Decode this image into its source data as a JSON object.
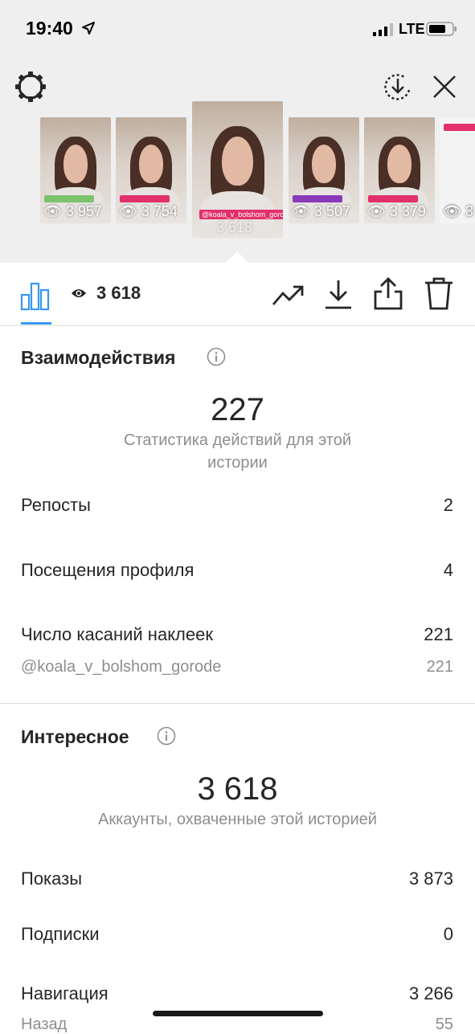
{
  "status_bar": {
    "time": "19:40",
    "network": "LTE"
  },
  "thumbnails": [
    {
      "views": "3 957",
      "selected": false
    },
    {
      "views": "3 754",
      "selected": false
    },
    {
      "views": "3 618",
      "selected": true,
      "sticker": "@koala_v_bolshom_gorode"
    },
    {
      "views": "3 507",
      "selected": false
    },
    {
      "views": "3 379",
      "selected": false
    },
    {
      "views": "3",
      "selected": false
    }
  ],
  "toolbar": {
    "views_count": "3 618"
  },
  "interactions": {
    "title": "Взаимодействия",
    "total": "227",
    "caption": "Статистика действий для этой истории",
    "rows": [
      {
        "label": "Репосты",
        "value": "2"
      },
      {
        "label": "Посещения профиля",
        "value": "4"
      },
      {
        "label": "Число касаний наклеек",
        "value": "221"
      }
    ],
    "sub_row": {
      "label": "@koala_v_bolshom_gorode",
      "value": "221"
    }
  },
  "discovery": {
    "title": "Интересное",
    "total": "3 618",
    "caption": "Аккаунты, охваченные этой историей",
    "rows": [
      {
        "label": "Показы",
        "value": "3 873"
      },
      {
        "label": "Подписки",
        "value": "0"
      },
      {
        "label": "Навигация",
        "value": "3 266"
      }
    ],
    "sub_row": {
      "label": "Назад",
      "value": "55"
    }
  },
  "colors": {
    "accent": "#3897f0",
    "top_background": "#efefef",
    "secondary_text": "#8e8e8e"
  }
}
